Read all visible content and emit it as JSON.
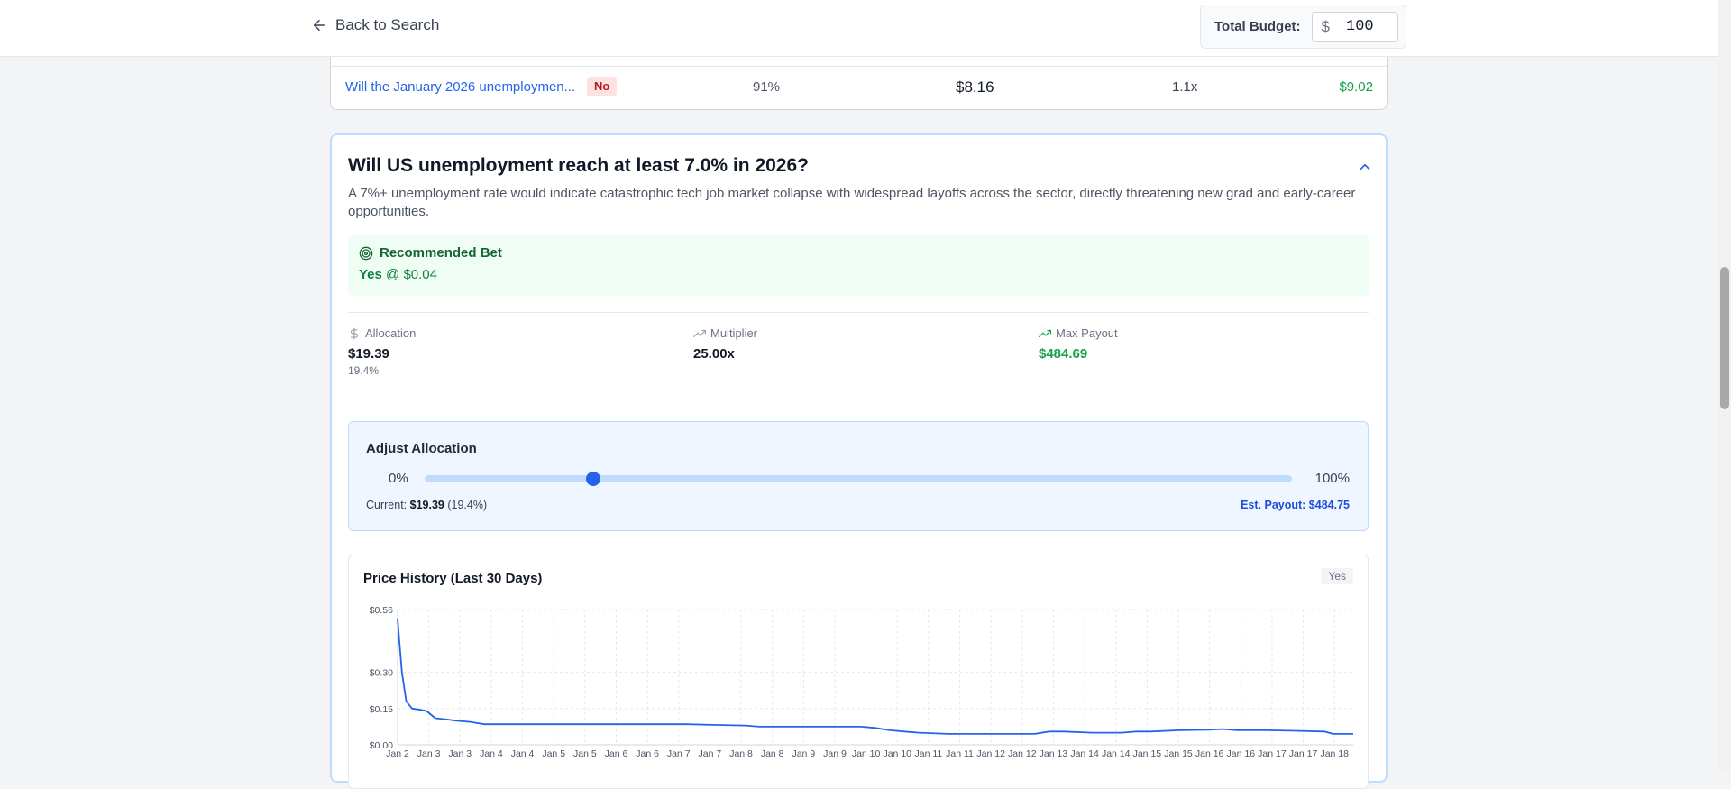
{
  "header": {
    "back_label": "Back to Search",
    "budget_label": "Total Budget:",
    "currency_symbol": "$",
    "budget_value": "100"
  },
  "previous_row": {
    "question": "Will the January 2026 unemploymen...",
    "side": "No",
    "probability": "91%",
    "cost": "$8.16",
    "multiplier": "1.1x",
    "payout": "$9.02"
  },
  "market": {
    "title": "Will US unemployment reach at least 7.0% in 2026?",
    "description": "A 7%+ unemployment rate would indicate catastrophic tech job market collapse with widespread layoffs across the sector, directly threatening new grad and early-career opportunities.",
    "recommended": {
      "heading": "Recommended Bet",
      "side": "Yes",
      "price_text": "@ $0.04"
    },
    "stats": {
      "allocation_label": "Allocation",
      "allocation_value": "$19.39",
      "allocation_pct": "19.4%",
      "multiplier_label": "Multiplier",
      "multiplier_value": "25.00x",
      "max_payout_label": "Max Payout",
      "max_payout_value": "$484.69"
    },
    "adjust": {
      "title": "Adjust Allocation",
      "min_label": "0%",
      "max_label": "100%",
      "slider_value_pct": 19.4,
      "current_prefix": "Current:",
      "current_value": "$19.39",
      "current_pct": "(19.4%)",
      "est_payout": "Est. Payout: $484.75"
    },
    "colors": {
      "accent": "#2563eb",
      "positive": "#16a34a",
      "negative_badge": "#b91c1c"
    }
  },
  "chart_data": {
    "type": "line",
    "title": "Price History (Last 30 Days)",
    "series_badge": "Yes",
    "y_ticks": [
      "$0.56",
      "$0.30",
      "$0.15",
      "$0.00"
    ],
    "y_tick_values": [
      0.56,
      0.3,
      0.15,
      0.0
    ],
    "ylim": [
      0,
      0.56
    ],
    "x_tick_labels": [
      "Jan 2",
      "Jan 3",
      "Jan 3",
      "Jan 4",
      "Jan 4",
      "Jan 5",
      "Jan 5",
      "Jan 6",
      "Jan 6",
      "Jan 7",
      "Jan 7",
      "Jan 8",
      "Jan 8",
      "Jan 9",
      "Jan 9",
      "Jan 10",
      "Jan 10",
      "Jan 11",
      "Jan 11",
      "Jan 12",
      "Jan 12",
      "Jan 13",
      "Jan 14",
      "Jan 14",
      "Jan 15",
      "Jan 15",
      "Jan 16",
      "Jan 16",
      "Jan 17",
      "Jan 17",
      "Jan 18"
    ],
    "grid": true,
    "series": [
      {
        "color": "#2563eb",
        "points": [
          [
            0.0,
            0.52
          ],
          [
            0.15,
            0.3
          ],
          [
            0.3,
            0.18
          ],
          [
            0.5,
            0.15
          ],
          [
            0.8,
            0.145
          ],
          [
            1.0,
            0.14
          ],
          [
            1.3,
            0.11
          ],
          [
            1.7,
            0.105
          ],
          [
            2.0,
            0.1
          ],
          [
            2.5,
            0.095
          ],
          [
            3.0,
            0.085
          ],
          [
            4.0,
            0.085
          ],
          [
            5.0,
            0.085
          ],
          [
            6.0,
            0.085
          ],
          [
            7.0,
            0.085
          ],
          [
            8.0,
            0.085
          ],
          [
            9.0,
            0.085
          ],
          [
            10.0,
            0.085
          ],
          [
            11.0,
            0.082
          ],
          [
            12.0,
            0.08
          ],
          [
            12.5,
            0.075
          ],
          [
            13.0,
            0.075
          ],
          [
            14.0,
            0.075
          ],
          [
            15.0,
            0.075
          ],
          [
            16.0,
            0.075
          ],
          [
            16.5,
            0.07
          ],
          [
            17.0,
            0.06
          ],
          [
            17.5,
            0.055
          ],
          [
            18.0,
            0.05
          ],
          [
            19.0,
            0.045
          ],
          [
            20.0,
            0.045
          ],
          [
            21.0,
            0.045
          ],
          [
            22.0,
            0.045
          ],
          [
            22.5,
            0.055
          ],
          [
            23.0,
            0.055
          ],
          [
            24.0,
            0.05
          ],
          [
            25.0,
            0.05
          ],
          [
            25.5,
            0.055
          ],
          [
            26.0,
            0.055
          ],
          [
            27.0,
            0.06
          ],
          [
            28.0,
            0.062
          ],
          [
            28.5,
            0.065
          ],
          [
            29.0,
            0.06
          ],
          [
            30.0,
            0.06
          ],
          [
            31.0,
            0.058
          ],
          [
            32.0,
            0.055
          ],
          [
            32.3,
            0.045
          ],
          [
            33.0,
            0.045
          ]
        ]
      }
    ]
  }
}
